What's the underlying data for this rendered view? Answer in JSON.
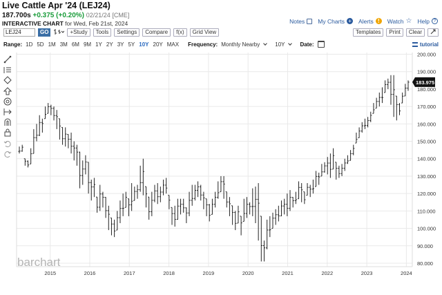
{
  "header": {
    "title": "Live Cattle Apr '24 (LEJ24)",
    "price": "187.700s",
    "change": "+0.375 (+0.20%)",
    "meta": "02/21/24 [CME]",
    "subtitle_bold": "INTERACTIVE CHART",
    "subtitle_rest": "for Wed, Feb 21st, 2024"
  },
  "top_links": {
    "notes": "Notes",
    "my_charts": "My Charts",
    "alerts": "Alerts",
    "watch": "Watch",
    "help": "Help"
  },
  "toolbar": {
    "symbol_value": "LEJ24",
    "go": "GO",
    "study": "+Study",
    "tools": "Tools",
    "settings": "Settings",
    "compare": "Compare",
    "fx": "f(x)",
    "grid_view": "Grid View",
    "templates": "Templates",
    "print": "Print",
    "clear": "Clear"
  },
  "range_bar": {
    "range_label": "Range:",
    "ranges": [
      "1D",
      "5D",
      "1M",
      "3M",
      "6M",
      "9M",
      "1Y",
      "2Y",
      "3Y",
      "5Y",
      "10Y",
      "20Y",
      "MAX"
    ],
    "selected": "10Y",
    "frequency_label": "Frequency:",
    "frequency_value": "Monthly Nearby",
    "period_value": "10Y",
    "date_label": "Date:",
    "tutorial": "tutorial"
  },
  "sidebar_icons": [
    "draw-line-icon",
    "fib-lines-icon",
    "shape-icon",
    "arrow-icon",
    "target-icon",
    "measure-icon",
    "magnet-icon",
    "lock-icon",
    "undo-icon",
    "redo-icon"
  ],
  "watermark": "barchart",
  "last_price_label": "183.975",
  "colors": {
    "bars": "#222222",
    "grid": "#e9e9e9",
    "last_price_bg": "#111111",
    "link": "#2a5a9e",
    "change": "#1a9c3a"
  },
  "chart_data": {
    "type": "ohlc",
    "title": "Live Cattle Apr '24 (LEJ24)",
    "frequency": "Monthly Nearby",
    "ylim": [
      78,
      201
    ],
    "y_ticks": [
      "200.000",
      "190.000",
      "180.000",
      "170.000",
      "160.000",
      "150.000",
      "140.000",
      "130.000",
      "120.000",
      "110.000",
      "100.000",
      "90.000",
      "80.000"
    ],
    "x_ticks": [
      "2015",
      "2016",
      "2017",
      "2018",
      "2019",
      "2020",
      "2021",
      "2022",
      "2023",
      "2024"
    ],
    "x_start": 2014.15,
    "x_end": 2024.15,
    "last_price": 183.975,
    "highs": [
      147,
      148,
      140,
      139,
      146,
      157,
      160,
      165,
      163,
      170,
      172,
      171,
      170,
      168,
      163,
      158,
      158,
      154,
      155,
      150,
      148,
      144,
      139,
      142,
      138,
      128,
      129,
      118,
      125,
      121,
      118,
      113,
      106,
      105,
      110,
      116,
      120,
      121,
      117,
      126,
      124,
      125,
      136,
      140,
      124,
      118,
      121,
      125,
      126,
      124,
      128,
      129,
      119,
      112,
      113,
      117,
      117,
      117,
      112,
      121,
      125,
      125,
      127,
      125,
      121,
      117,
      114,
      117,
      121,
      127,
      130,
      130,
      121,
      118,
      113,
      110,
      113,
      107,
      117,
      118,
      115,
      123,
      124,
      126,
      107,
      93,
      105,
      107,
      109,
      111,
      113,
      116,
      117,
      120,
      122,
      118,
      121,
      127,
      126,
      121,
      126,
      125,
      128,
      133,
      132,
      137,
      138,
      141,
      143,
      146,
      138,
      136,
      137,
      140,
      142,
      145,
      148,
      155,
      158,
      161,
      163,
      164,
      167,
      172,
      175,
      178,
      181,
      185,
      186,
      188,
      188,
      176,
      172,
      178,
      183,
      185
    ],
    "lows": [
      143,
      144,
      136,
      135,
      137,
      143,
      150,
      153,
      155,
      163,
      166,
      165,
      162,
      157,
      151,
      148,
      147,
      146,
      143,
      139,
      136,
      123,
      125,
      131,
      120,
      116,
      118,
      109,
      110,
      112,
      106,
      99,
      96,
      95,
      99,
      103,
      107,
      112,
      107,
      110,
      116,
      117,
      121,
      119,
      112,
      105,
      107,
      115,
      114,
      115,
      119,
      120,
      111,
      102,
      101,
      105,
      108,
      109,
      103,
      107,
      113,
      116,
      118,
      116,
      111,
      107,
      104,
      108,
      112,
      117,
      121,
      117,
      112,
      107,
      102,
      99,
      103,
      96,
      104,
      106,
      108,
      107,
      103,
      93,
      81,
      81,
      88,
      95,
      100,
      102,
      104,
      107,
      108,
      107,
      110,
      112,
      114,
      117,
      115,
      114,
      119,
      118,
      120,
      124,
      125,
      130,
      132,
      131,
      129,
      134,
      128,
      129,
      130,
      133,
      137,
      139,
      142,
      149,
      152,
      155,
      157,
      158,
      161,
      166,
      169,
      170,
      172,
      178,
      180,
      171,
      164,
      162,
      165,
      172,
      176,
      179
    ]
  }
}
